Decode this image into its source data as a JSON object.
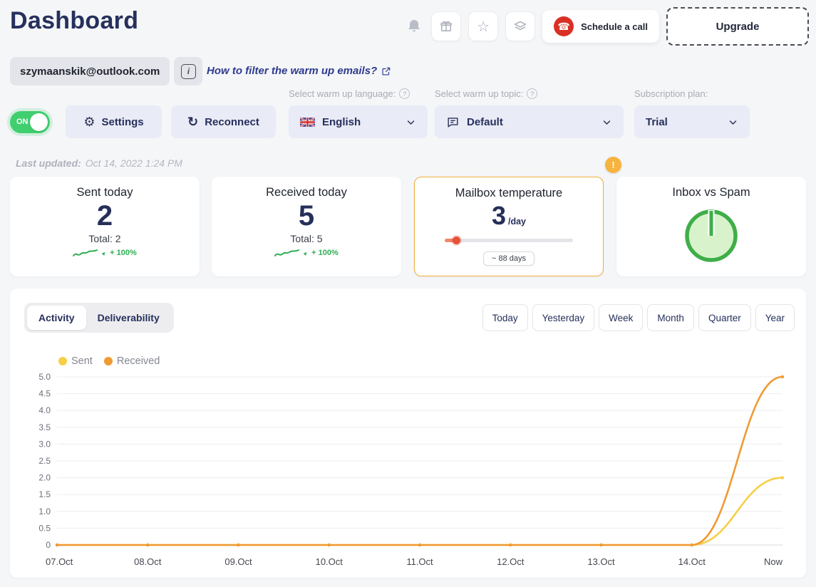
{
  "header": {
    "title": "Dashboard",
    "schedule_call": "Schedule a call",
    "upgrade": "Upgrade"
  },
  "account": {
    "email": "szymaanskik@outlook.com",
    "help_link": "How to filter the warm up emails?"
  },
  "controls": {
    "toggle_label": "ON",
    "settings": "Settings",
    "reconnect": "Reconnect",
    "language_label": "Select warm up language:",
    "language_value": "English",
    "topic_label": "Select warm up topic:",
    "topic_value": "Default",
    "plan_label": "Subscription plan:",
    "plan_value": "Trial"
  },
  "last_updated": {
    "label": "Last updated:",
    "value": "Oct 14, 2022 1:24 PM"
  },
  "icons": {
    "gear": "⚙",
    "refresh": "↻",
    "star": "☆",
    "phone": "☎",
    "info": "i",
    "help": "?",
    "warning": "!"
  },
  "stats": {
    "sent": {
      "title": "Sent today",
      "value": "2",
      "total": "Total: 2",
      "change": "+ 100%"
    },
    "received": {
      "title": "Received today",
      "value": "5",
      "total": "Total: 5",
      "change": "+ 100%"
    },
    "temperature": {
      "title": "Mailbox temperature",
      "value": "3",
      "unit": "/day",
      "estimate": "~ 88 days"
    },
    "inbox_spam": {
      "title": "Inbox vs Spam"
    }
  },
  "chart_section": {
    "tabs": [
      {
        "label": "Activity",
        "active": true
      },
      {
        "label": "Deliverability",
        "active": false
      }
    ],
    "ranges": [
      "Today",
      "Yesterday",
      "Week",
      "Month",
      "Quarter",
      "Year"
    ],
    "legend": [
      {
        "label": "Sent",
        "color": "#f7cf47"
      },
      {
        "label": "Received",
        "color": "#f09a33"
      }
    ]
  },
  "chart_data": {
    "type": "line",
    "x": [
      "07.Oct",
      "08.Oct",
      "09.Oct",
      "10.Oct",
      "11.Oct",
      "12.Oct",
      "13.Oct",
      "14.Oct",
      "Now"
    ],
    "series": [
      {
        "name": "Sent",
        "color": "#f7cf47",
        "values": [
          0,
          0,
          0,
          0,
          0,
          0,
          0,
          0,
          2
        ]
      },
      {
        "name": "Received",
        "color": "#f09a33",
        "values": [
          0,
          0,
          0,
          0,
          0,
          0,
          0,
          0,
          5
        ]
      }
    ],
    "ylim": [
      0,
      5
    ],
    "yticks": [
      0,
      0.5,
      1.0,
      1.5,
      2.0,
      2.5,
      3.0,
      3.5,
      4.0,
      4.5,
      5.0
    ],
    "grid": true,
    "legend_position": "top-left"
  },
  "colors": {
    "navy": "#262f58",
    "accent_orange": "#efae3c",
    "green": "#2fae54",
    "toggle_green": "#3fcf6e",
    "link_blue": "#2e3b8d",
    "temp_dot_red": "#e8503a"
  }
}
